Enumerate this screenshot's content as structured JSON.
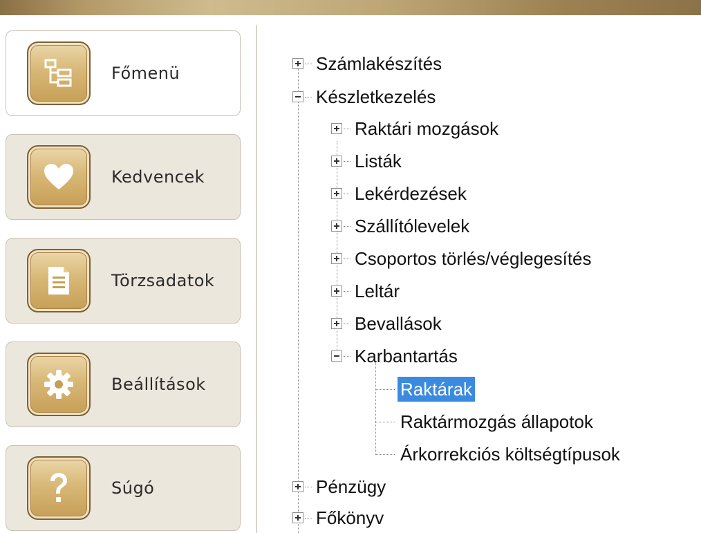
{
  "nav": {
    "items": [
      {
        "label": "Főmenü",
        "icon": "tree-structure-icon"
      },
      {
        "label": "Kedvencek",
        "icon": "heart-icon"
      },
      {
        "label": "Törzsadatok",
        "icon": "document-icon"
      },
      {
        "label": "Beállítások",
        "icon": "gear-icon"
      },
      {
        "label": "Súgó",
        "icon": "question-mark-icon"
      }
    ]
  },
  "tree": {
    "szamlakeszites": "Számlakészítés",
    "keszletkezeles": "Készletkezelés",
    "raktari_mozgasok": "Raktári mozgások",
    "listak": "Listák",
    "lekerdezesek": "Lekérdezések",
    "szallitolevelek": "Szállítólevelek",
    "csoportos": "Csoportos törlés/véglegesítés",
    "leltar": "Leltár",
    "bevallasok": "Bevallások",
    "karbantartas": "Karbantartás",
    "raktarak": "Raktárak",
    "raktarmozgas_allapotok": "Raktármozgás állapotok",
    "arkorrekcios": "Árkorrekciós költségtípusok",
    "penzugy": "Pénzügy",
    "fokonyv": "Főkönyv"
  },
  "colors": {
    "gold": "#c69e55",
    "selection": "#3a8be0"
  }
}
